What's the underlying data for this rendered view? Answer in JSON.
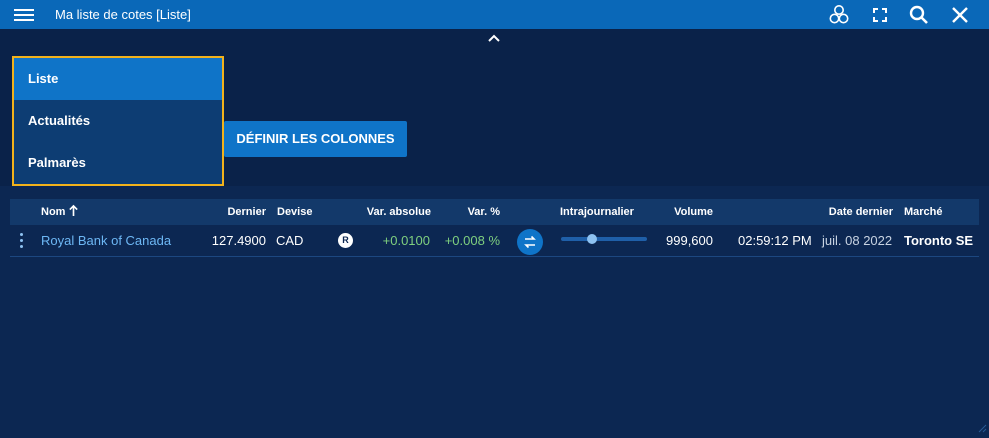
{
  "window": {
    "title": "Ma liste de cotes [Liste]",
    "icons": [
      "menu-icon",
      "circles-icon",
      "fullscreen-icon",
      "search-icon",
      "close-icon"
    ]
  },
  "dropdown": {
    "items": [
      {
        "label": "Liste",
        "active": true
      },
      {
        "label": "Actualités",
        "active": false
      },
      {
        "label": "Palmarès",
        "active": false
      }
    ]
  },
  "define_columns_button": "DÉFINIR LES COLONNES",
  "table": {
    "headers": {
      "nom": "Nom",
      "dernier": "Dernier",
      "devise": "Devise",
      "var_absolue": "Var. absolue",
      "var_pct": "Var. %",
      "intrajournalier": "Intrajournalier",
      "volume": "Volume",
      "date_dernier": "Date dernier",
      "marche": "Marché"
    },
    "sort": {
      "column": "Nom",
      "direction": "ascending"
    },
    "rows": [
      {
        "nom": "Royal Bank of Canada",
        "dernier": "127.4900",
        "devise": "CAD",
        "badge": "R",
        "var_absolue": "+0.0100",
        "var_pct": "+0.008 %",
        "intrajournalier_level": 0.36,
        "volume": "999,600",
        "heure": "02:59:12 PM",
        "date_dernier": "juil. 08 2022",
        "marche": "Toronto SE"
      }
    ]
  },
  "colors": {
    "titlebar": "#0a68b8",
    "background": "#0c2752",
    "accent": "#0f74c8",
    "highlight_border": "#f2b21b",
    "positive": "#7fd07f",
    "link": "#6db7f4"
  }
}
